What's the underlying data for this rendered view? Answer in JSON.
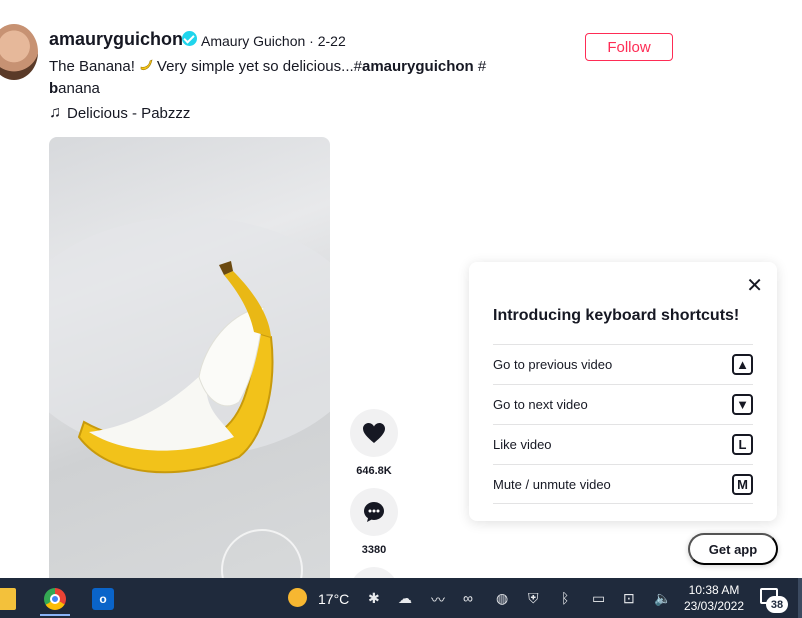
{
  "post": {
    "username": "amauryguichon",
    "nickname": "Amaury Guichon · 2-22",
    "follow_label": "Follow",
    "desc_text": "The Banana!",
    "desc_text2": "Very simple yet so delicious...#",
    "hashtag1": "amauryguichon",
    "hashtag_sep": " #",
    "hashtag2_a": "b",
    "hashtag2_b": "anana",
    "music": "Delicious - Pabzzz"
  },
  "actions": {
    "likes": "646.8K",
    "comments": "3380"
  },
  "shortcuts": {
    "close_icon": "close-icon",
    "title": "Introducing keyboard shortcuts!",
    "items": [
      {
        "label": "Go to previous video",
        "key": "▲"
      },
      {
        "label": "Go to next video",
        "key": "▼"
      },
      {
        "label": "Like video",
        "key": "L"
      },
      {
        "label": "Mute / unmute video",
        "key": "M"
      }
    ]
  },
  "get_app": "Get app",
  "taskbar": {
    "temperature": "17°C",
    "time": "10:38 AM",
    "date": "23/03/2022",
    "notifications": "38"
  },
  "colors": {
    "accent": "#fe2c55",
    "verified": "#20d5ec",
    "taskbar": "#1f2a3c"
  }
}
